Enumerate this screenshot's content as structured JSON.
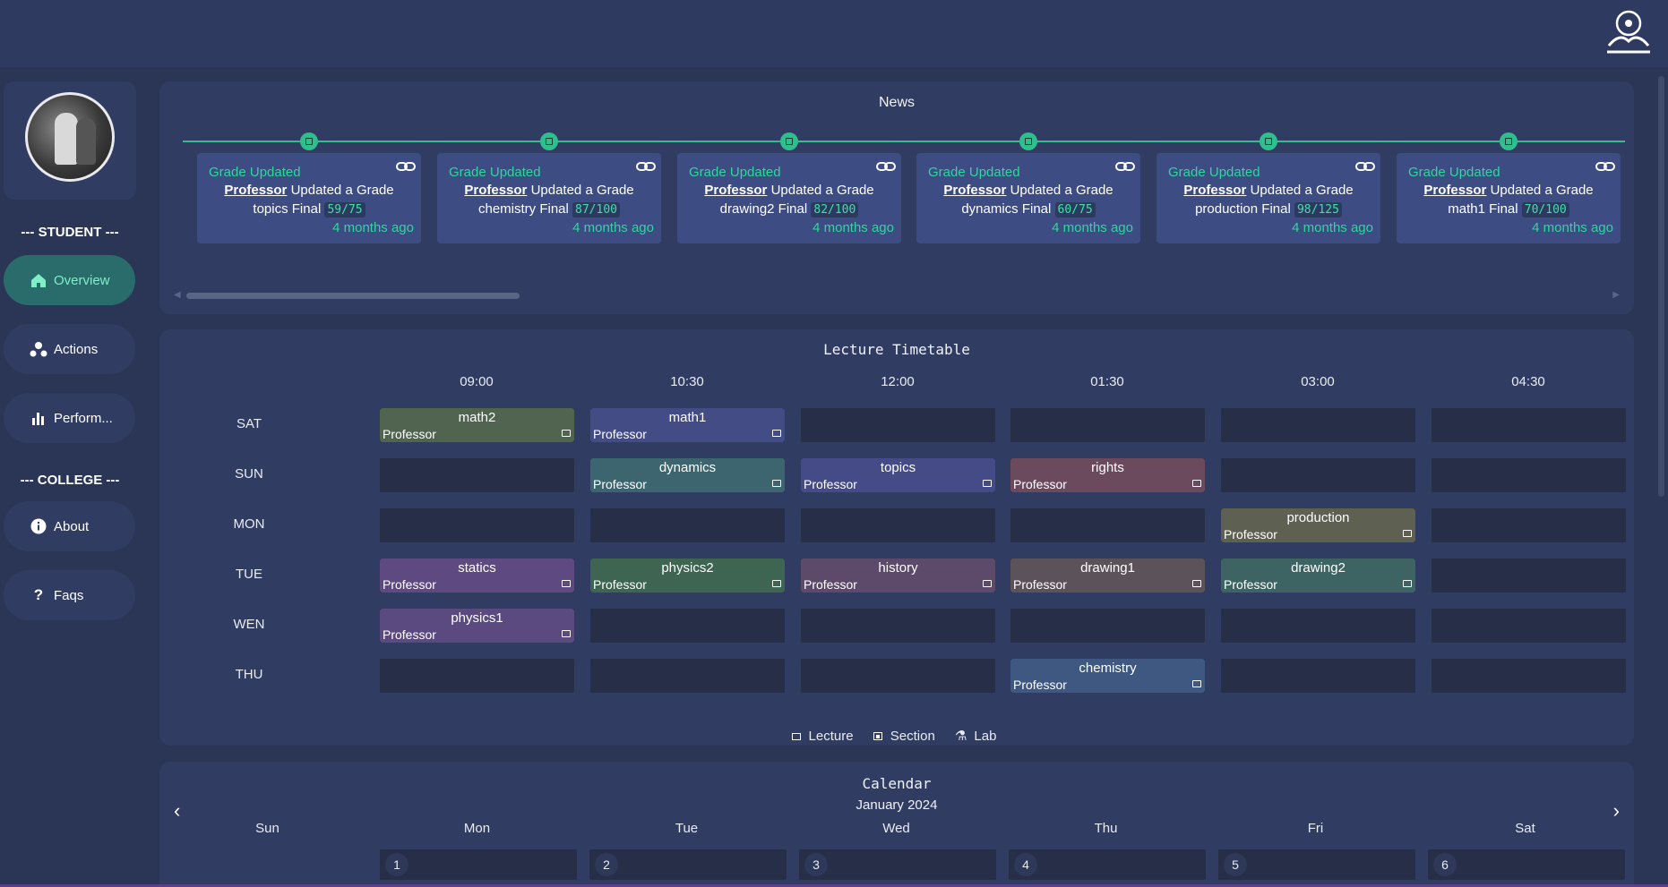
{
  "sidebar": {
    "student_label": "--- STUDENT ---",
    "college_label": "--- COLLEGE ---",
    "items": [
      {
        "label": "Overview",
        "icon": "home-icon",
        "active": true
      },
      {
        "label": "Actions",
        "icon": "actions-icon",
        "active": false
      },
      {
        "label": "Perform...",
        "icon": "bar-chart-icon",
        "active": false
      },
      {
        "label": "About",
        "icon": "info-icon",
        "active": false
      },
      {
        "label": "Faqs",
        "icon": "question-icon",
        "active": false
      }
    ]
  },
  "news": {
    "title": "News",
    "items": [
      {
        "type": "Grade Updated",
        "author": "Professor",
        "action": "Updated a Grade",
        "subject": "topics Final",
        "grade": "59/75",
        "ago": "4 months ago"
      },
      {
        "type": "Grade Updated",
        "author": "Professor",
        "action": "Updated a Grade",
        "subject": "chemistry Final",
        "grade": "87/100",
        "ago": "4 months ago"
      },
      {
        "type": "Grade Updated",
        "author": "Professor",
        "action": "Updated a Grade",
        "subject": "drawing2 Final",
        "grade": "82/100",
        "ago": "4 months ago"
      },
      {
        "type": "Grade Updated",
        "author": "Professor",
        "action": "Updated a Grade",
        "subject": "dynamics Final",
        "grade": "60/75",
        "ago": "4 months ago"
      },
      {
        "type": "Grade Updated",
        "author": "Professor",
        "action": "Updated a Grade",
        "subject": "production Final",
        "grade": "98/125",
        "ago": "4 months ago"
      },
      {
        "type": "Grade Updated",
        "author": "Professor",
        "action": "Updated a Grade",
        "subject": "math1 Final",
        "grade": "70/100",
        "ago": "4 months ago"
      }
    ]
  },
  "timetable": {
    "title": "Lecture Timetable",
    "times": [
      "09:00",
      "10:30",
      "12:00",
      "01:30",
      "03:00",
      "04:30"
    ],
    "days": [
      "SAT",
      "SUN",
      "MON",
      "TUE",
      "WEN",
      "THU"
    ],
    "classes": [
      {
        "day": 0,
        "slot": 0,
        "name": "math2",
        "prof": "Professor",
        "color": "#51644f"
      },
      {
        "day": 0,
        "slot": 1,
        "name": "math1",
        "prof": "Professor",
        "color": "#434c85"
      },
      {
        "day": 1,
        "slot": 1,
        "name": "dynamics",
        "prof": "Professor",
        "color": "#3d6570"
      },
      {
        "day": 1,
        "slot": 2,
        "name": "topics",
        "prof": "Professor",
        "color": "#454b87"
      },
      {
        "day": 1,
        "slot": 3,
        "name": "rights",
        "prof": "Professor",
        "color": "#6b4a5d"
      },
      {
        "day": 2,
        "slot": 4,
        "name": "production",
        "prof": "Professor",
        "color": "#5e6051"
      },
      {
        "day": 3,
        "slot": 0,
        "name": "statics",
        "prof": "Professor",
        "color": "#5e4980"
      },
      {
        "day": 3,
        "slot": 1,
        "name": "physics2",
        "prof": "Professor",
        "color": "#3e6452"
      },
      {
        "day": 3,
        "slot": 2,
        "name": "history",
        "prof": "Professor",
        "color": "#5d4a6b"
      },
      {
        "day": 3,
        "slot": 3,
        "name": "drawing1",
        "prof": "Professor",
        "color": "#5b5359"
      },
      {
        "day": 3,
        "slot": 4,
        "name": "drawing2",
        "prof": "Professor",
        "color": "#3d6462"
      },
      {
        "day": 4,
        "slot": 0,
        "name": "physics1",
        "prof": "Professor",
        "color": "#5a4a80"
      },
      {
        "day": 5,
        "slot": 3,
        "name": "chemistry",
        "prof": "Professor",
        "color": "#3e5882"
      }
    ],
    "legend": {
      "lecture": "Lecture",
      "section": "Section",
      "lab": "Lab"
    }
  },
  "calendar": {
    "title": "Calendar",
    "month": "January 2024",
    "weekdays": [
      "Sun",
      "Mon",
      "Tue",
      "Wed",
      "Thu",
      "Fri",
      "Sat"
    ],
    "days": [
      "1",
      "2",
      "3",
      "4",
      "5",
      "6"
    ]
  },
  "colors": {
    "accent": "#2fd69e",
    "background": "#2b3556",
    "panel": "#313c62"
  }
}
